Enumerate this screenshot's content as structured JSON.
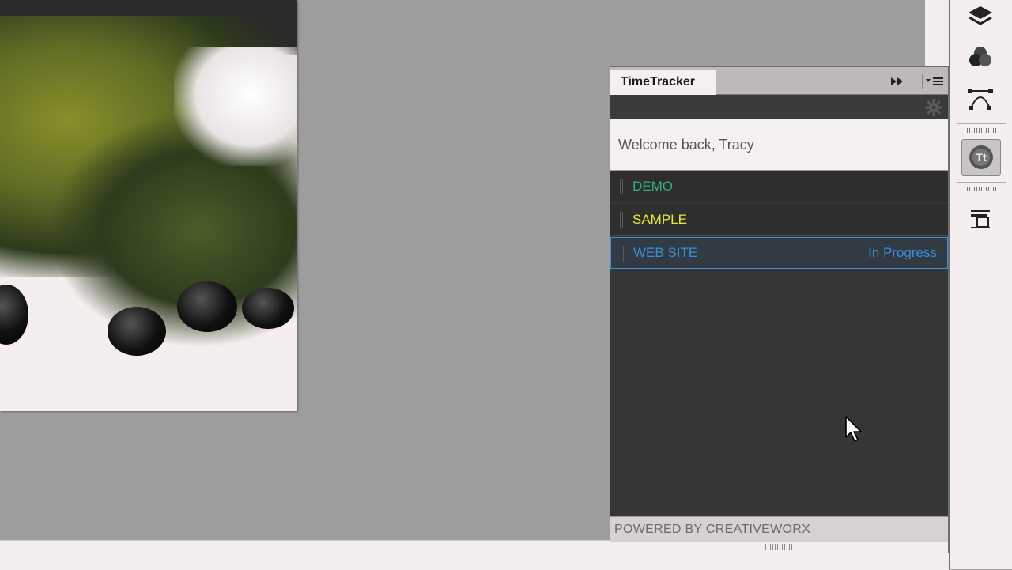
{
  "panel": {
    "tab_title": "TimeTracker",
    "welcome_text": "Welcome back, Tracy",
    "footer_text": "POWERED BY CREATIVEWORX"
  },
  "projects": [
    {
      "name": "DEMO",
      "color": "#2fb57a",
      "status": ""
    },
    {
      "name": "SAMPLE",
      "color": "#e8e83a",
      "status": ""
    },
    {
      "name": "WEB SITE",
      "color": "#3a8fdc",
      "status": "In Progress"
    }
  ],
  "dock": {
    "icons": [
      "layers-icon",
      "channels-icon",
      "paths-icon",
      "timetracker-icon",
      "properties-icon"
    ]
  },
  "colors": {
    "panel_bg": "#363636",
    "active_border": "#3e8fe0"
  }
}
